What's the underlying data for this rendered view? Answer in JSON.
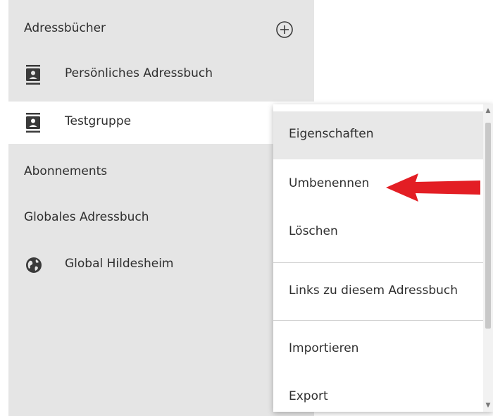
{
  "sidebar": {
    "address_books_header": "Adressbücher",
    "add_icon": "plus-circle-icon",
    "personal_item": {
      "label": "Persönliches Adressbuch",
      "icon": "address-book-icon"
    },
    "test_item": {
      "label": "Testgruppe",
      "icon": "address-book-icon"
    },
    "subscriptions_header": "Abonnements",
    "global_header": "Globales Adressbuch",
    "global_item": {
      "label": "Global Hildesheim",
      "icon": "globe-icon"
    }
  },
  "context_menu": {
    "items": [
      {
        "label": "Eigenschaften"
      },
      {
        "label": "Umbenennen"
      },
      {
        "label": "Löschen"
      },
      {
        "label": "Links zu diesem Adressbuch"
      },
      {
        "label": "Importieren"
      },
      {
        "label": "Export"
      }
    ]
  },
  "colors": {
    "sidebar_bg": "#e5e5e5",
    "selected_bg": "#ffffff",
    "hover_bg": "#e8e8e8",
    "annotation_arrow": "#e31e24"
  }
}
